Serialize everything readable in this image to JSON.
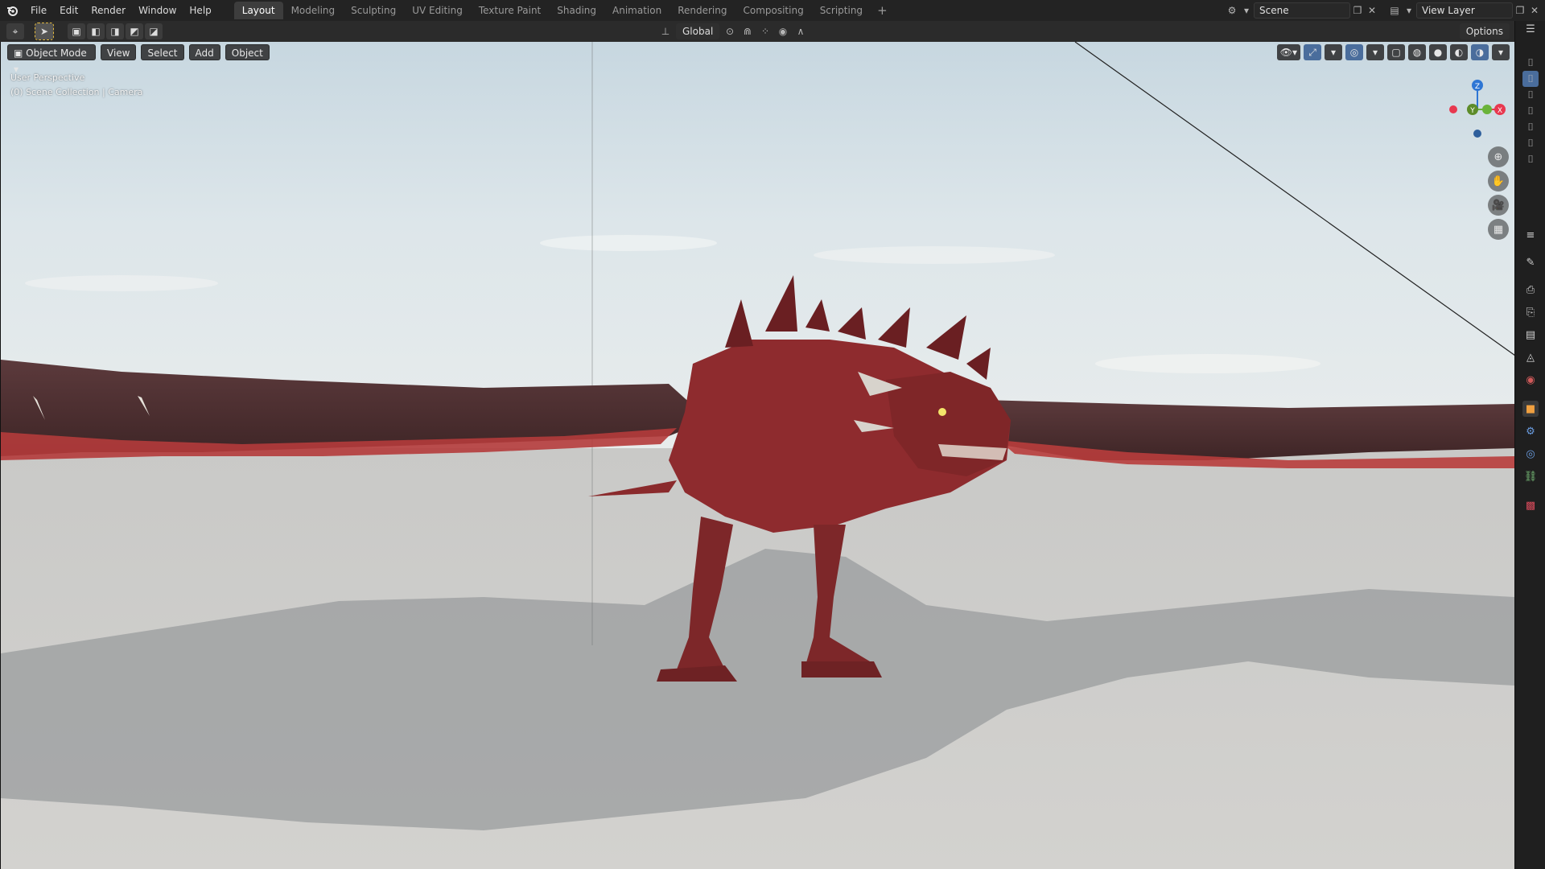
{
  "topbar": {
    "menus": [
      "File",
      "Edit",
      "Render",
      "Window",
      "Help"
    ],
    "workspaces": [
      "Layout",
      "Modeling",
      "Sculpting",
      "UV Editing",
      "Texture Paint",
      "Shading",
      "Animation",
      "Rendering",
      "Compositing",
      "Scripting"
    ],
    "active_workspace": "Layout",
    "add_workspace": "+",
    "scene_name": "Scene",
    "view_layer": "View Layer"
  },
  "header2": {
    "orientation": "Global",
    "options_label": "Options"
  },
  "viewport": {
    "mode": "Object Mode",
    "menus": [
      "View",
      "Select",
      "Add",
      "Object"
    ],
    "perspective_label": "User Perspective",
    "collection_label": "(0) Scene Collection | Camera",
    "gizmo_axes": {
      "x": "X",
      "y": "Y",
      "z": "Z"
    }
  },
  "colors": {
    "accent_blue": "#4a6d9c",
    "x_axis": "#e8384f",
    "y_axis": "#6ab33a",
    "z_axis": "#2e76d4",
    "dragon_red": "#8e2b2e"
  },
  "icons": {
    "logo": "blender-logo-icon",
    "properties_tabs": [
      "tool-icon",
      "render-icon",
      "output-icon",
      "view-layer-icon",
      "scene-icon",
      "world-icon",
      "object-icon",
      "modifier-icon",
      "particles-icon",
      "physics-icon",
      "constraints-icon",
      "data-icon",
      "material-icon"
    ]
  }
}
